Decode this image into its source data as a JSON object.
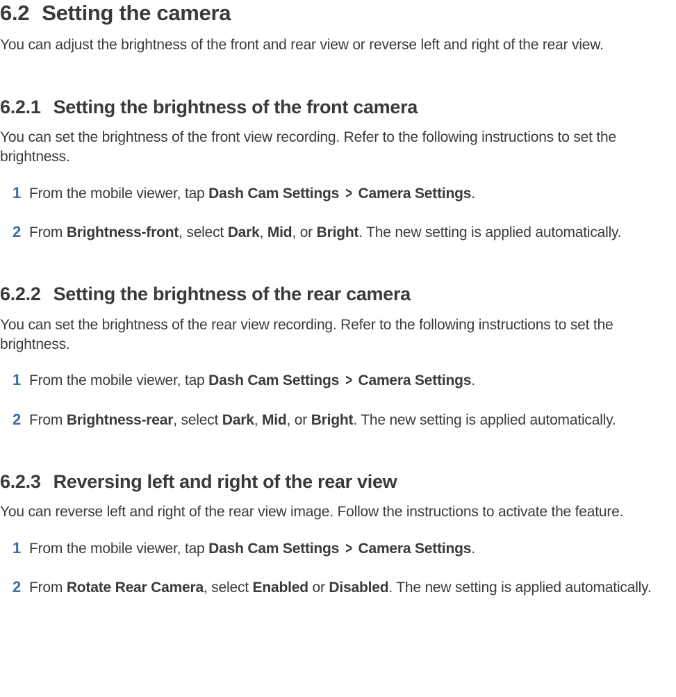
{
  "section": {
    "number": "6.2",
    "title": "Setting the camera",
    "intro": "You can adjust the brightness of the front and rear view or reverse left and right of the rear view."
  },
  "sub1": {
    "number": "6.2.1",
    "title": "Setting the brightness of the front camera",
    "intro": "You can set the brightness of the front view recording. Refer to the following instructions to set the brightness.",
    "step1": {
      "n": "1",
      "pre": "From the mobile viewer, tap ",
      "b1": "Dash Cam Settings",
      "chev": ">",
      "b2": "Camera Settings",
      "post": "."
    },
    "step2": {
      "n": "2",
      "t1": "From ",
      "b1": "Brightness-front",
      "t2": ", select ",
      "b2": "Dark",
      "t3": ", ",
      "b3": "Mid",
      "t4": ", or ",
      "b4": "Bright",
      "t5": ". The new setting is applied automatically."
    }
  },
  "sub2": {
    "number": "6.2.2",
    "title": "Setting the brightness of the rear camera",
    "intro": "You can set the brightness of the rear view recording. Refer to the following instructions to set the brightness.",
    "step1": {
      "n": "1",
      "pre": "From the mobile viewer, tap ",
      "b1": "Dash Cam Settings",
      "chev": ">",
      "b2": "Camera Settings",
      "post": "."
    },
    "step2": {
      "n": "2",
      "t1": "From ",
      "b1": "Brightness-rear",
      "t2": ", select ",
      "b2": "Dark",
      "t3": ", ",
      "b3": "Mid",
      "t4": ", or ",
      "b4": "Bright",
      "t5": ". The new setting is applied automatically."
    }
  },
  "sub3": {
    "number": "6.2.3",
    "title": "Reversing left and right of the rear view",
    "intro": "You can reverse left and right of the rear view image. Follow the instructions to activate the feature.",
    "step1": {
      "n": "1",
      "pre": "From the mobile viewer, tap ",
      "b1": "Dash Cam Settings",
      "chev": ">",
      "b2": "Camera Settings",
      "post": "."
    },
    "step2": {
      "n": "2",
      "t1": "From ",
      "b1": "Rotate Rear Camera",
      "t2": ", select ",
      "b2": "Enabled",
      "t3": " or ",
      "b3": "Disabled",
      "t4": ". The new setting is applied automatically."
    }
  }
}
